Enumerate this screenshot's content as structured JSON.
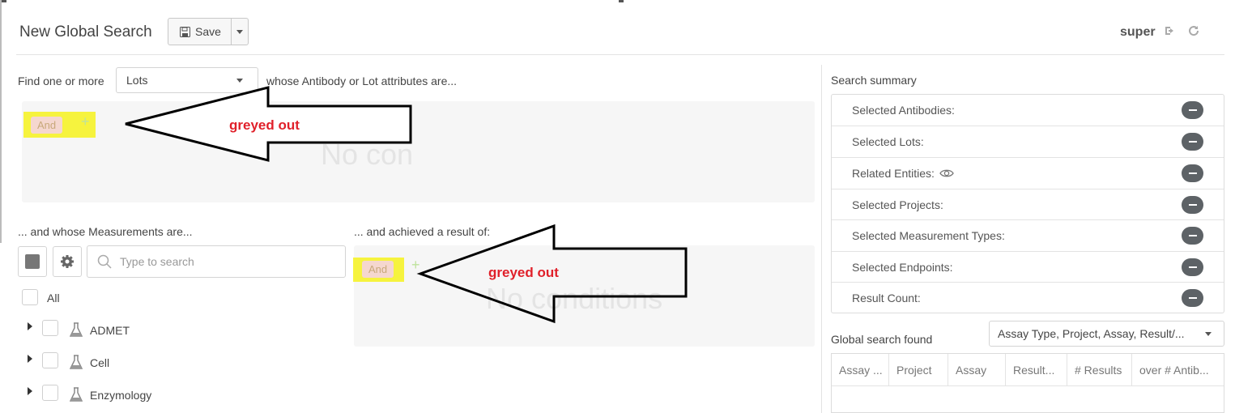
{
  "header": {
    "title": "New Global Search",
    "save_label": "Save",
    "user": "super"
  },
  "find": {
    "prefix": "Find one or more",
    "entity": "Lots",
    "suffix": "whose Antibody or Lot attributes are..."
  },
  "attr_conditions": {
    "and_label": "And",
    "plus": "+",
    "empty_text": "No con"
  },
  "measurements": {
    "heading": "... and whose Measurements are...",
    "search_placeholder": "Type to search",
    "all_label": "All",
    "tree": [
      {
        "label": "ADMET"
      },
      {
        "label": "Cell"
      },
      {
        "label": "Enzymology"
      }
    ]
  },
  "results": {
    "heading": "... and achieved a result of:",
    "and_label": "And",
    "plus": "+",
    "empty_text": "No conditions"
  },
  "annotations": {
    "top": "greyed out",
    "bottom": "greyed out"
  },
  "summary": {
    "heading": "Search summary",
    "rows": [
      {
        "label": "Selected Antibodies:"
      },
      {
        "label": "Selected Lots:"
      },
      {
        "label": "Related Entities:",
        "icon": "eye-icon"
      },
      {
        "label": "Selected Projects:"
      },
      {
        "label": "Selected Measurement Types:"
      },
      {
        "label": "Selected Endpoints:"
      },
      {
        "label": "Result Count:"
      }
    ]
  },
  "global_results": {
    "heading": "Global search found",
    "select_value": "Assay Type, Project, Assay, Result/...",
    "columns": [
      "Assay ...",
      "Project",
      "Assay",
      "Result...",
      "# Results",
      "over # Antib..."
    ]
  },
  "colors": {
    "highlight": "#f6f200",
    "annotation_text": "#e0202a",
    "minus_button": "#5d6266"
  }
}
